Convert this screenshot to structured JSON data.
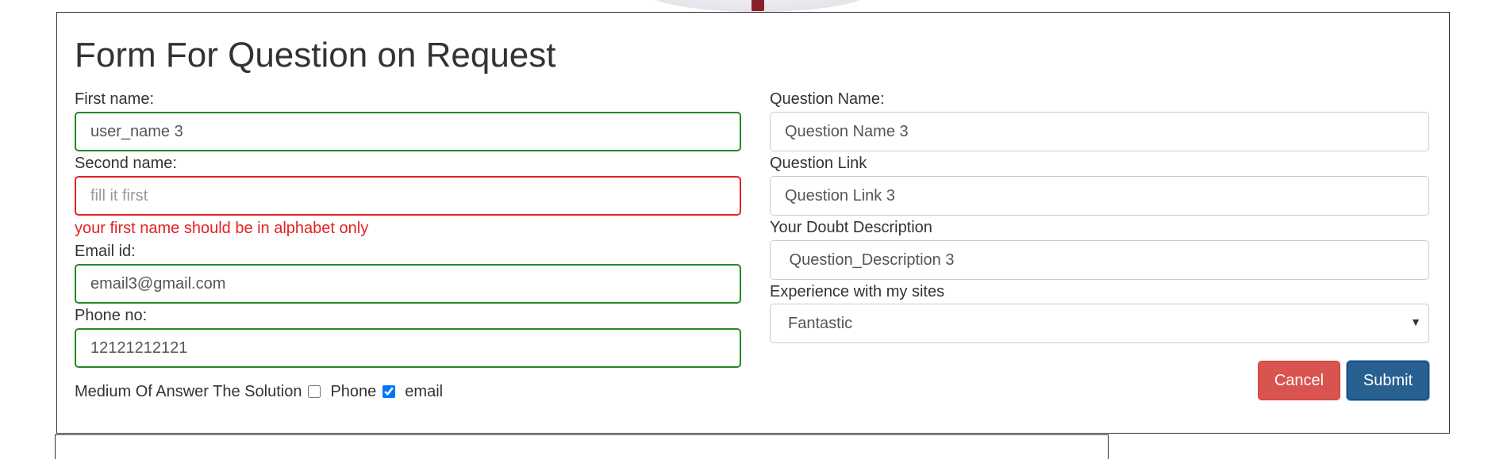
{
  "form": {
    "title": "Form For Question on Request",
    "first_name": {
      "label": "First name:",
      "value": "user_name 3",
      "status": "valid"
    },
    "second_name": {
      "label": "Second name:",
      "value": "",
      "placeholder": "fill it first",
      "status": "invalid",
      "error": "your first name should be in alphabet only"
    },
    "email": {
      "label": "Email id:",
      "value": "email3@gmail.com",
      "status": "valid"
    },
    "phone": {
      "label": "Phone no:",
      "value": "12121212121",
      "status": "valid"
    },
    "question_name": {
      "label": "Question Name:",
      "value": "Question Name 3"
    },
    "question_link": {
      "label": "Question Link",
      "value": "Question Link 3"
    },
    "doubt_description": {
      "label": "Your Doubt Description",
      "value": " Question_Description 3"
    },
    "experience": {
      "label": "Experience with my sites",
      "selected": "Fantastic"
    },
    "medium": {
      "label": "Medium Of Answer The Solution",
      "options": [
        {
          "label": "Phone",
          "checked": false
        },
        {
          "label": "email",
          "checked": true
        }
      ]
    },
    "buttons": {
      "cancel": "Cancel",
      "submit": "Submit"
    }
  },
  "colors": {
    "valid_border": "#1f8a24",
    "invalid_border": "#e32222",
    "error_text": "#e32222",
    "cancel_bg": "#d9534f",
    "submit_bg": "#286090"
  },
  "icons": {
    "select_arrow": "caret-down-icon"
  }
}
